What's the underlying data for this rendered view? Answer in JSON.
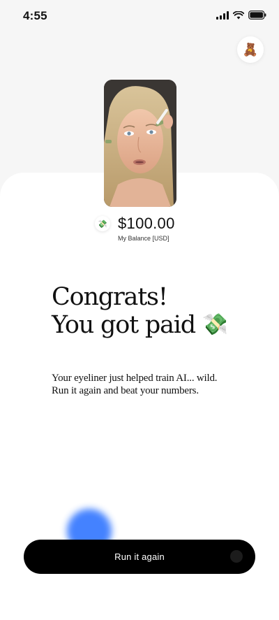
{
  "status_bar": {
    "time": "4:55"
  },
  "header": {
    "avatar_emoji": "🧸"
  },
  "media": {
    "thumbnail": "eyeliner-video-thumbnail"
  },
  "balance": {
    "icon_emoji": "💸",
    "amount": "$100.00",
    "label": "My Balance [USD]"
  },
  "headline": {
    "line1": "Congrats!",
    "line2": "You got paid",
    "emoji": "💸"
  },
  "subtext": {
    "line1": "Your eyeliner just helped train AI... wild.",
    "line2": "Run it again and beat your numbers."
  },
  "cta": {
    "label": "Run it again"
  },
  "colors": {
    "accent_blue": "#3b7cff",
    "button_bg": "#000000",
    "background": "#f6f6f6",
    "sheet": "#ffffff"
  }
}
